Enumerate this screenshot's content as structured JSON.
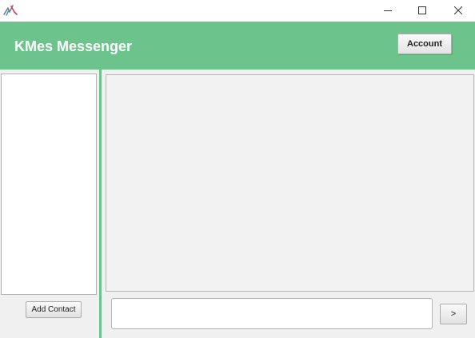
{
  "window": {
    "icons": {
      "app": "lightning-app-icon",
      "minimize": "minimize-icon",
      "maximize": "maximize-icon",
      "close": "close-icon"
    }
  },
  "header": {
    "title": "KMes Messenger",
    "account_label": "Account",
    "background": "#6cc48c"
  },
  "contacts": {
    "add_contact_label": "Add Contact"
  },
  "chat": {
    "message_value": "",
    "send_label": ">"
  },
  "colors": {
    "accent": "#6cc48c",
    "panel": "#f2f2f2",
    "window": "#f0f0f0"
  }
}
